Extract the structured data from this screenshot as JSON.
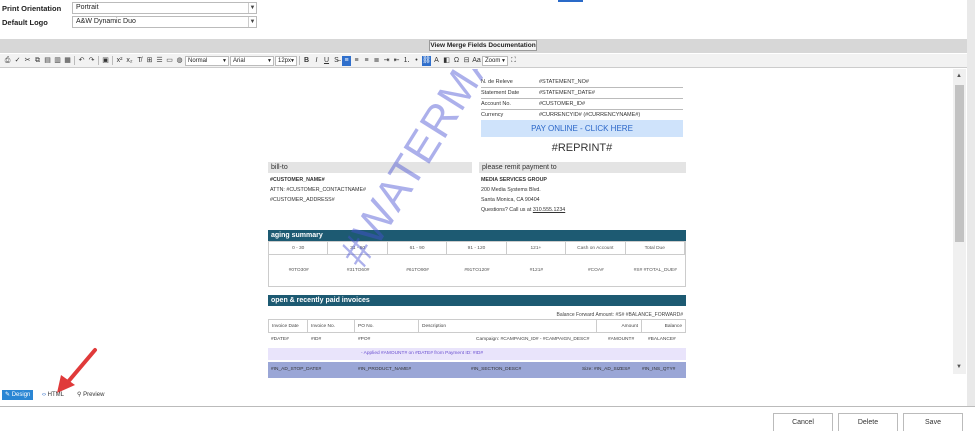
{
  "settings": {
    "print_orientation": {
      "label": "Print Orientation",
      "value": "Portrait"
    },
    "default_logo": {
      "label": "Default Logo",
      "value": "A&W Dynamic Duo"
    }
  },
  "merge_button": "View Merge Fields Documentation",
  "toolbar": {
    "format": "Normal",
    "font": "Arial",
    "size": "12px",
    "zoom": "Zoom"
  },
  "statement": {
    "rows": [
      {
        "label": "N. de Releve",
        "value": "#STATEMENT_NO#"
      },
      {
        "label": "Statement Date",
        "value": "#STATEMENT_DATE#"
      },
      {
        "label": "Account No.",
        "value": "#CUSTOMER_ID#"
      },
      {
        "label": "Currency",
        "value": "#CURRENCYID# (#CURRENCYNAME#)"
      }
    ],
    "pay_online": "PAY ONLINE - CLICK HERE",
    "reprint": "#REPRINT#"
  },
  "bill_to": {
    "heading": "bill-to",
    "line1": "#CUSTOMER_NAME#",
    "line2": "ATTN: #CUSTOMER_CONTACTNAME#",
    "line3": "#CUSTOMER_ADDRESS#"
  },
  "remit": {
    "heading": "please remit payment to",
    "line1": "MEDIA SERVICES GROUP",
    "line2": "200 Media Systems Blvd.",
    "line3": "Santa Monica, CA 90404",
    "line4_prefix": "Questions? Call us at ",
    "phone": "310.555.1234"
  },
  "aging": {
    "heading": "aging summary",
    "columns": [
      "0 - 30",
      "31 - 60",
      "61 - 90",
      "91 - 120",
      "121+",
      "Cash on Account",
      "Total Due"
    ],
    "values": [
      "#0TO30#",
      "#31TO60#",
      "#61TO90#",
      "#91TO120#",
      "#121#",
      "#COA#",
      "#S# #TOTAL_DUE#"
    ]
  },
  "invoices": {
    "heading": "open & recently paid invoices",
    "balance_forward": "Balance Forward Amount:  #S# #BALANCE_FORWARD#",
    "columns": [
      "Invoice Date",
      "Invoice No.",
      "PO No.",
      "Description",
      "Amount",
      "Balance"
    ],
    "row": {
      "date": "#DATE#",
      "id": "#ID#",
      "po": "#PO#",
      "desc": "Campaign: #CAMPAIGN_ID# - #CAMPAIGN_DESC#",
      "amount": "#AMOUNT#",
      "balance": "#BALANCE#"
    },
    "applied": "- Applied #AMOUNT# on #DATE# from Payment ID: #ID#",
    "ad_row": {
      "stop_date": "#IN_AD_STOP_DATE#",
      "product": "#IN_PRODUCT_NAME#",
      "section": "#IN_SECTION_DESC#",
      "size": "Size: #IN_AD_SIZES#",
      "ins": "#IN_INS_QTY#"
    }
  },
  "watermark": "#WATERMARK#",
  "modes": {
    "design": "Design",
    "html": "HTML",
    "preview": "Preview"
  },
  "footer": {
    "cancel": "Cancel",
    "delete": "Delete",
    "save": "Save"
  },
  "colors": {
    "accent": "#2a86d4",
    "teal": "#1d5a72",
    "pay_bg": "#cfe3fb",
    "annotation_arrow": "#e03a3a"
  }
}
